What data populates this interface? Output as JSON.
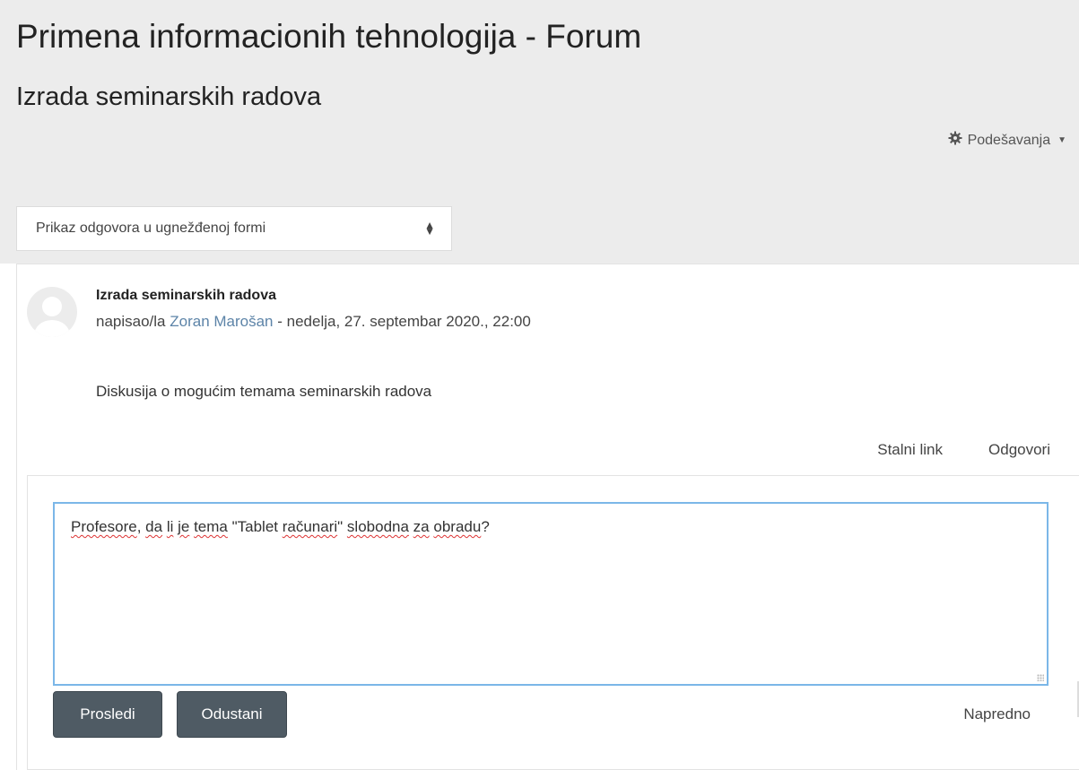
{
  "page": {
    "title": "Primena informacionih tehnologija - Forum",
    "forum_name": "Izrada seminarskih radova"
  },
  "settings_menu": {
    "label": "Podešavanja",
    "icon": "gear-icon"
  },
  "display_mode": {
    "selected": "Prikaz odgovora u ugnežđenoj formi"
  },
  "post": {
    "subject": "Izrada seminarskih radova",
    "byline_prefix": "napisao/la ",
    "author": "Zoran Marošan",
    "byline_suffix": " - nedelja, 27. septembar 2020., 22:00",
    "message": "Diskusija o mogućim temama seminarskih radova",
    "commands": {
      "permalink": "Stalni link",
      "reply": "Odgovori"
    }
  },
  "reply_form": {
    "text_parts": [
      "Profesore",
      ", ",
      "da",
      " ",
      "li",
      " ",
      "je",
      " ",
      "tema",
      " \"Tablet ",
      "računari",
      "\" ",
      "slobodna",
      " ",
      "za",
      " ",
      "obradu",
      "?"
    ],
    "submit_label": "Prosledi",
    "cancel_label": "Odustani",
    "advanced_label": "Napredno"
  },
  "colors": {
    "header_band": "#ececec",
    "link": "#5d84a8",
    "button": "#4f5b64",
    "focus_border": "#7bb7e8"
  }
}
